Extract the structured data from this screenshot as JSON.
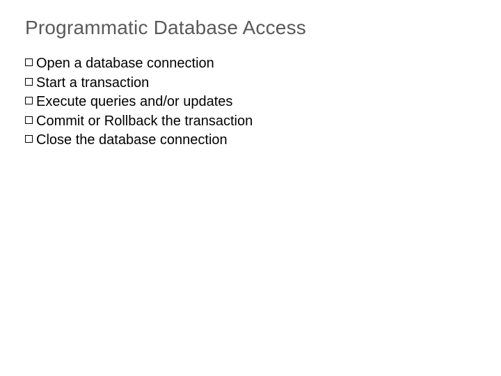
{
  "title": "Programmatic Database Access",
  "bullets": [
    "Open a database connection",
    "Start a transaction",
    "Execute queries and/or updates",
    "Commit or Rollback the transaction",
    "Close the database connection"
  ]
}
